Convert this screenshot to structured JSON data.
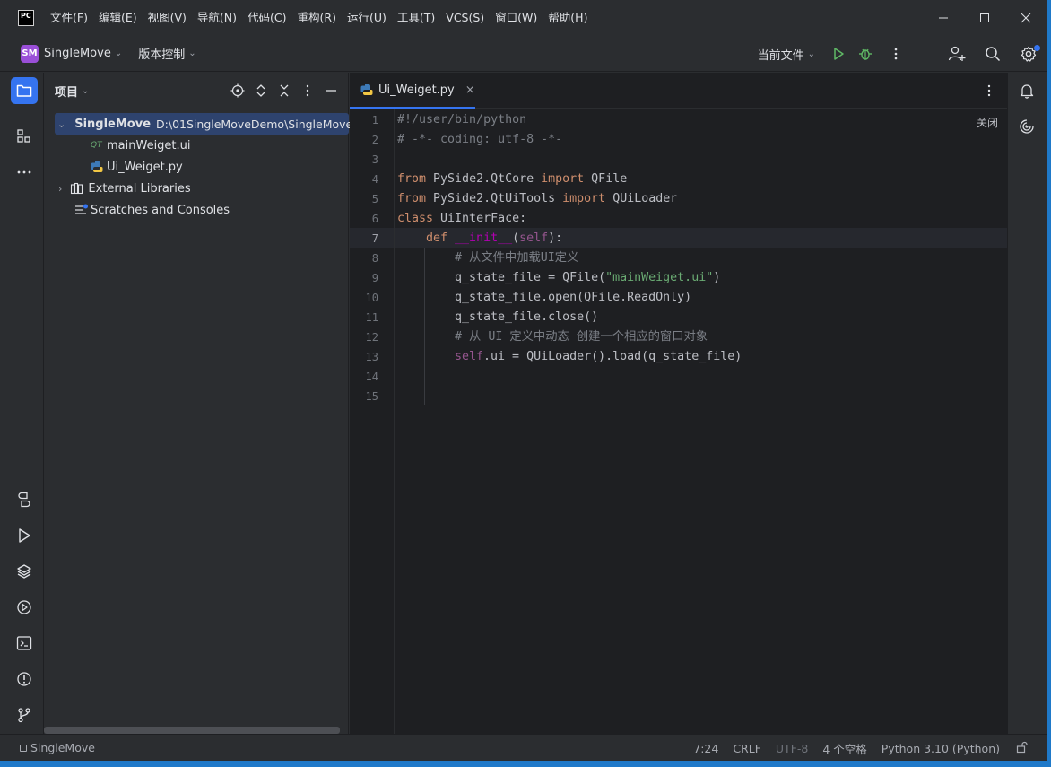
{
  "app": {
    "logo_text": "PC"
  },
  "menu": [
    "文件(F)",
    "编辑(E)",
    "视图(V)",
    "导航(N)",
    "代码(C)",
    "重构(R)",
    "运行(U)",
    "工具(T)",
    "VCS(S)",
    "窗口(W)",
    "帮助(H)"
  ],
  "toolbar": {
    "project_badge": "SM",
    "project_name": "SingleMove",
    "vcs_label": "版本控制",
    "run_config": "当前文件"
  },
  "project_panel": {
    "title": "项目",
    "tree": [
      {
        "label": "SingleMove",
        "path": "D:\\01SingleMoveDemo\\SingleMove",
        "icon": "folder-icon"
      },
      {
        "label": "mainWeiget.ui",
        "icon": "qt-file-icon",
        "icon_text": "QT"
      },
      {
        "label": "Ui_Weiget.py",
        "icon": "python-file-icon"
      },
      {
        "label": "External Libraries",
        "icon": "library-icon"
      },
      {
        "label": "Scratches and Consoles",
        "icon": "scratches-icon"
      }
    ]
  },
  "editor": {
    "tab_label": "Ui_Weiget.py",
    "close_hint": "关闭",
    "current_line": 7,
    "line_numbers": [
      "1",
      "2",
      "3",
      "4",
      "5",
      "6",
      "7",
      "8",
      "9",
      "10",
      "11",
      "12",
      "13",
      "14",
      "15"
    ],
    "code": {
      "l1": "#!/user/bin/python",
      "l2": "# -*- coding: utf-8 -*-",
      "l4_kw1": "from",
      "l4_mod": " PySide2.QtCore ",
      "l4_kw2": "import",
      "l4_name": " QFile",
      "l5_kw1": "from",
      "l5_mod": " PySide2.QtUiTools ",
      "l5_kw2": "import",
      "l5_name": " QUiLoader",
      "l6_kw": "class",
      "l6_rest": " UiInterFace:",
      "l7_kw": "def",
      "l7_sp": " ",
      "l7_fn": "__init__",
      "l7_p1": "(",
      "l7_self": "self",
      "l7_p2": "):",
      "l8": "# 从文件中加载UI定义",
      "l9_a": "q_state_file = QFile(",
      "l9_str": "\"mainWeiget.ui\"",
      "l9_b": ")",
      "l10": "q_state_file.open(QFile.ReadOnly)",
      "l11": "q_state_file.close()",
      "l12": "# 从 UI 定义中动态 创建一个相应的窗口对象",
      "l13_self": "self",
      "l13_rest": ".ui = QUiLoader().load(q_state_file)"
    }
  },
  "statusbar": {
    "project": "SingleMove",
    "position": "7:24",
    "line_sep": "CRLF",
    "encoding": "UTF-8",
    "indent": "4 个空格",
    "interpreter": "Python 3.10 (Python)"
  },
  "colors": {
    "accent": "#3574f0",
    "badge": "#9a4fd8",
    "run": "#5fb865"
  }
}
